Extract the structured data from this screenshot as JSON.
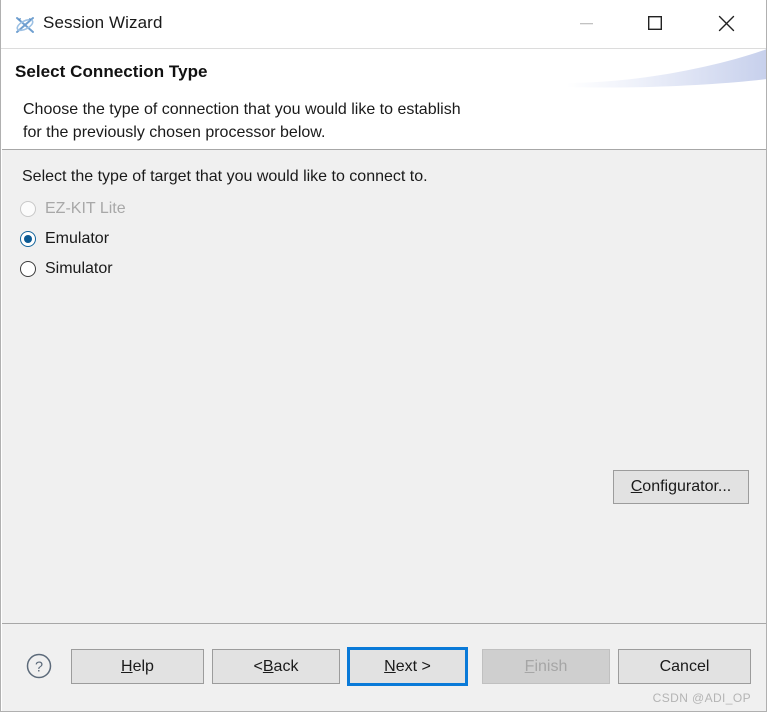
{
  "window": {
    "title": "Session Wizard",
    "icon": "crossed-arrows-icon",
    "controls": {
      "minimize": "minimize-icon",
      "maximize": "maximize-icon",
      "close": "close-icon"
    }
  },
  "header": {
    "title": "Select Connection Type",
    "description_line1": "Choose the type of connection that you would like to establish",
    "description_line2": "for the previously chosen processor below."
  },
  "main": {
    "prompt": "Select the type of target that you would like to connect to.",
    "options": [
      {
        "label": "EZ-KIT Lite",
        "selected": false,
        "disabled": true
      },
      {
        "label": "Emulator",
        "selected": true,
        "disabled": false
      },
      {
        "label": "Simulator",
        "selected": false,
        "disabled": false
      }
    ],
    "configurator": {
      "mnemonic": "C",
      "rest": "onfigurator..."
    }
  },
  "footer": {
    "help_icon": "question-mark-icon",
    "buttons": [
      {
        "name": "help",
        "pre": "",
        "mnemonic": "H",
        "post": "elp",
        "disabled": false,
        "focused": false
      },
      {
        "name": "back",
        "pre": "< ",
        "mnemonic": "B",
        "post": "ack",
        "disabled": false,
        "focused": false
      },
      {
        "name": "next",
        "pre": "",
        "mnemonic": "N",
        "post": "ext >",
        "disabled": false,
        "focused": true
      },
      {
        "name": "finish",
        "pre": "",
        "mnemonic": "F",
        "post": "inish",
        "disabled": true,
        "focused": false
      },
      {
        "name": "cancel",
        "pre": "",
        "mnemonic": "",
        "post": "Cancel",
        "disabled": false,
        "focused": false
      }
    ]
  },
  "watermark": "CSDN @ADI_OP",
  "colors": {
    "dialog_background": "#f0f0f0",
    "header_background": "#ffffff",
    "accent_focus": "#0a7ad8",
    "radio_selected": "#0b5a94",
    "separator": "#a7a7a7",
    "disabled_text": "#a6a6a6"
  }
}
